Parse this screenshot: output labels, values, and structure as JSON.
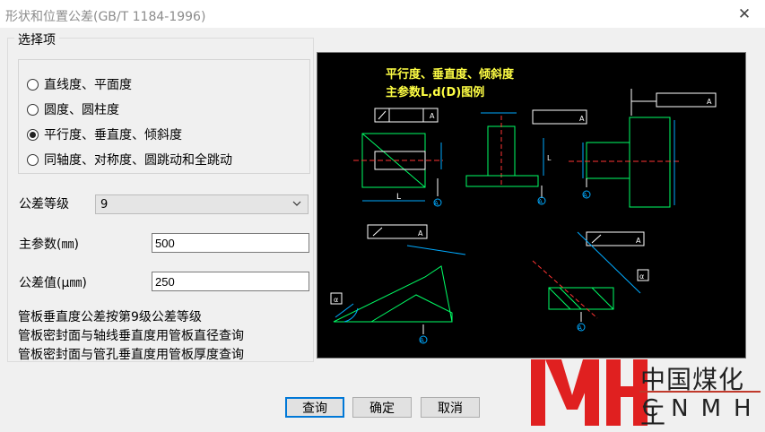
{
  "window": {
    "title": "形状和位置公差(GB/T 1184-1996)",
    "close_glyph": "✕"
  },
  "group": {
    "legend": "选择项"
  },
  "options": [
    {
      "label": "直线度、平面度",
      "checked": false
    },
    {
      "label": "圆度、圆柱度",
      "checked": false
    },
    {
      "label": "平行度、垂直度、倾斜度",
      "checked": true
    },
    {
      "label": "同轴度、对称度、圆跳动和全跳动",
      "checked": false
    }
  ],
  "form": {
    "grade_label": "公差等级",
    "grade_value": "9",
    "main_param_label": "主参数(㎜)",
    "main_param_value": "500",
    "tolerance_label": "公差值(μ㎜)",
    "tolerance_value": "250"
  },
  "info_lines": [
    "管板垂直度公差按第9级公差等级",
    "管板密封面与轴线垂直度用管板直径查询",
    "管板密封面与管孔垂直度用管板厚度查询"
  ],
  "diagram": {
    "title_line1": "平行度、垂直度、倾斜度",
    "title_line2": "主参数L,d(D)图例",
    "letter_A": "A",
    "letter_L": "L",
    "letter_d": "d",
    "letter_a": "α"
  },
  "buttons": {
    "query": "查询",
    "ok": "确定",
    "cancel": "取消"
  },
  "logo": {
    "cn": "中国煤化工",
    "en": "CNMHG",
    "colors": {
      "red": "#e02020",
      "dark": "#222222"
    }
  }
}
